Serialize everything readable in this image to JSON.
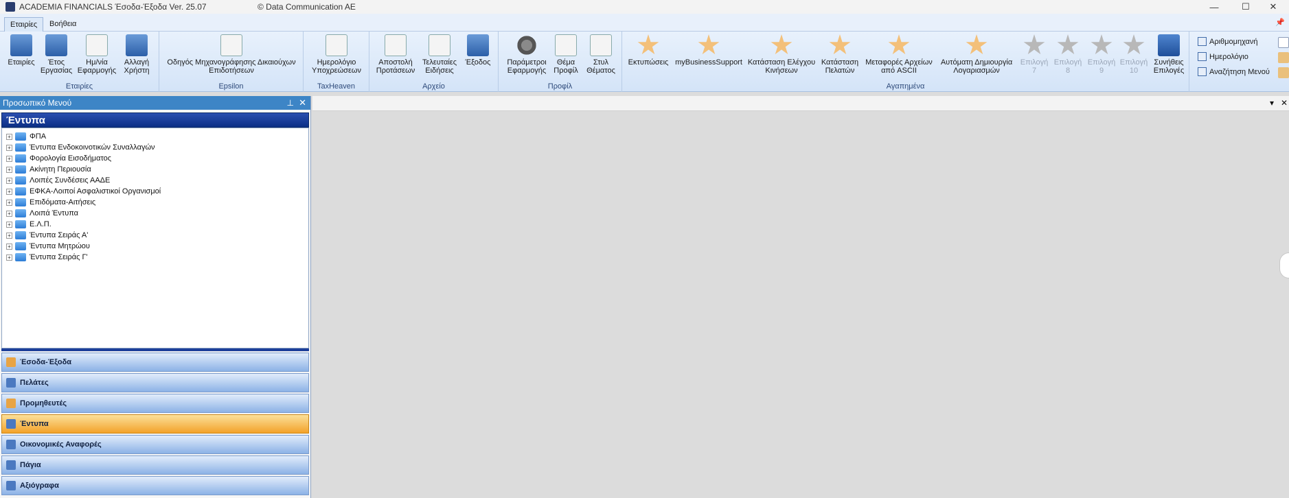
{
  "window": {
    "title": "ACADEMIA FINANCIALS Έσοδα-Έξοδα Ver. 25.07",
    "copyright": "© Data Communication AE",
    "minimize": "—",
    "maximize": "☐",
    "close": "✕"
  },
  "tabs": [
    {
      "label": "Εταιρίες",
      "active": true
    },
    {
      "label": "Βοήθεια",
      "active": false
    }
  ],
  "ribbon": {
    "groups": {
      "companies": {
        "label": "Εταιρίες",
        "buttons": [
          {
            "line1": "Εταιρίες",
            "line2": ""
          },
          {
            "line1": "Έτος",
            "line2": "Εργασίας"
          },
          {
            "line1": "Ημ/νία",
            "line2": "Εφαρμογής"
          },
          {
            "line1": "Αλλαγή",
            "line2": "Χρήστη"
          }
        ]
      },
      "epsilon": {
        "label": "Epsilon",
        "buttons": [
          {
            "line1": "Οδηγός Μηχανογράφησης Δικαιούχων",
            "line2": "Επιδοτήσεων"
          }
        ]
      },
      "taxheaven": {
        "label": "TaxHeaven",
        "buttons": [
          {
            "line1": "Ημερολόγιο",
            "line2": "Υποχρεώσεων"
          }
        ]
      },
      "file": {
        "label": "Αρχείο",
        "buttons": [
          {
            "line1": "Αποστολή",
            "line2": "Προτάσεων"
          },
          {
            "line1": "Τελευταίες",
            "line2": "Ειδήσεις"
          },
          {
            "line1": "Έξοδος",
            "line2": ""
          }
        ]
      },
      "profile": {
        "label": "Προφίλ",
        "buttons": [
          {
            "line1": "Παράμετροι",
            "line2": "Εφαρμογής"
          },
          {
            "line1": "Θέμα",
            "line2": "Προφίλ"
          },
          {
            "line1": "Στυλ",
            "line2": "Θέματος"
          }
        ]
      },
      "favorites": {
        "label": "Αγαπημένα",
        "buttons": [
          {
            "line1": "Εκτυπώσεις",
            "line2": "",
            "num": "1"
          },
          {
            "line1": "myBusinessSupport",
            "line2": "",
            "num": "2"
          },
          {
            "line1": "Κατάσταση Ελέγχου",
            "line2": "Κινήσεων",
            "num": "3"
          },
          {
            "line1": "Κατάσταση",
            "line2": "Πελατών",
            "num": "4"
          },
          {
            "line1": "Μεταφορές Αρχείων",
            "line2": "από ASCII",
            "num": "5"
          },
          {
            "line1": "Αυτόματη Δημιουργία",
            "line2": "Λογαριασμών",
            "num": "6"
          },
          {
            "line1": "Επιλογή 7",
            "line2": "",
            "num": "7"
          },
          {
            "line1": "Επιλογή 8",
            "line2": "",
            "num": "8"
          },
          {
            "line1": "Επιλογή 9",
            "line2": "",
            "num": "9"
          },
          {
            "line1": "Επιλογή",
            "line2": "10",
            "num": "10"
          },
          {
            "line1": "Συνήθεις",
            "line2": "Επιλογές",
            "num": ""
          }
        ]
      },
      "tools": [
        {
          "label": "Αριθμομηχανή"
        },
        {
          "label": "Ημερολόγιο"
        },
        {
          "label": "Αναζήτηση Μενού"
        }
      ]
    }
  },
  "panel": {
    "title": "Προσωπικό Μενού",
    "pin": "⊥",
    "close": "✕",
    "tree_title": "Έντυπα",
    "tree_items": [
      "ΦΠΑ",
      "Έντυπα Ενδοκοινοτικών Συναλλαγών",
      "Φορολογία  Εισοδήματος",
      "Ακίνητη Περιουσία",
      "Λοιπές Συνδέσεις ΑΑΔΕ",
      "ΕΦΚΑ-Λοιποί Ασφαλιστικοί Οργανισμοί",
      "Επιδόματα-Αιτήσεις",
      "Λοιπά Έντυπα",
      "Ε.Λ.Π.",
      "Έντυπα Σειράς Α'",
      "Έντυπα Μητρώου",
      "Έντυπα Σειράς Γ'"
    ],
    "nav_items": [
      {
        "label": "Έσοδα-Έξοδα",
        "active": false
      },
      {
        "label": "Πελάτες",
        "active": false
      },
      {
        "label": "Προμηθευτές",
        "active": false
      },
      {
        "label": "Έντυπα",
        "active": true
      },
      {
        "label": "Οικονομικές Αναφορές",
        "active": false
      },
      {
        "label": "Πάγια",
        "active": false
      },
      {
        "label": "Αξιόγραφα",
        "active": false
      }
    ]
  },
  "workspace": {
    "menu_glyph": "▾",
    "close_glyph": "✕"
  },
  "colors": {
    "accent": "#3d85c6",
    "active_nav": "#f3a22a",
    "tree_header": "#0b2f86"
  }
}
